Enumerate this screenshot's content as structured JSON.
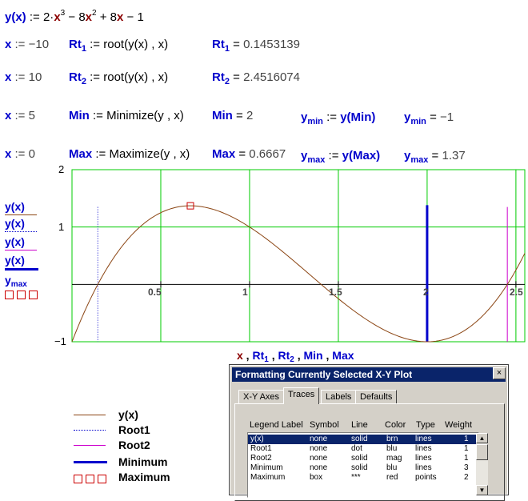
{
  "worksheet": {
    "def": {
      "lhs": "y(x)",
      "assign": ":=",
      "rhs_prefix": "2·",
      "x1": "x",
      "e3": "3",
      "mid": "− 8",
      "x2": "x",
      "e2": "2",
      "mid2": "+ 8",
      "x3": "x",
      "tail": "− 1"
    },
    "lines": [
      {
        "guess_var": "x",
        "guess_op": ":=",
        "guess_val": "−10",
        "name": "Rt",
        "name_sub": "1",
        "op": ":=",
        "func": "root",
        "args": "(y(x) , x)",
        "res_name": "Rt",
        "res_sub": "1",
        "res_eq": "=",
        "res_val": "0.1453139"
      },
      {
        "guess_var": "x",
        "guess_op": ":=",
        "guess_val": "10",
        "name": "Rt",
        "name_sub": "2",
        "op": ":=",
        "func": "root",
        "args": "(y(x) , x)",
        "res_name": "Rt",
        "res_sub": "2",
        "res_eq": "=",
        "res_val": "2.4516074"
      },
      {
        "guess_var": "x",
        "guess_op": ":=",
        "guess_val": "5",
        "name": "Min",
        "name_sub": "",
        "op": ":=",
        "func": "Minimize",
        "args": "(y , x)",
        "res_name": "Min",
        "res_sub": "",
        "res_eq": "=",
        "res_val": "2"
      },
      {
        "guess_var": "x",
        "guess_op": ":=",
        "guess_val": "0",
        "name": "Max",
        "name_sub": "",
        "op": ":=",
        "func": "Maximize",
        "args": "(y , x)",
        "res_name": "Max",
        "res_sub": "",
        "res_eq": "=",
        "res_val": "0.6667"
      }
    ],
    "ymin": {
      "def_name": "y",
      "def_sub": "min",
      "def_op": ":=",
      "def_expr": "y(Min)",
      "res_name": "y",
      "res_sub": "min",
      "res_eq": "=",
      "res_val": "−1"
    },
    "ymax": {
      "def_name": "y",
      "def_sub": "max",
      "def_op": ":=",
      "def_expr": "y(Max)",
      "res_name": "y",
      "res_sub": "max",
      "res_eq": "=",
      "res_val": "1.37"
    }
  },
  "plot": {
    "x_axis_expr": "x , Rt1 , Rt2 , Min , Max",
    "x_axis_parts": [
      "x",
      "Rt",
      "1",
      "Rt",
      "2",
      "Min",
      "Max"
    ],
    "y_axis_labels": [
      "y(x)",
      "y(x)",
      "y(x)",
      "y(x)",
      "ymax"
    ],
    "y_axis_last": {
      "base": "y",
      "sub": "max"
    },
    "y_ticks": [
      "2",
      "1",
      "−1"
    ],
    "x_ticks": [
      "0.5",
      "1",
      "1.5",
      "2",
      "2.5"
    ]
  },
  "chart_data": {
    "type": "line",
    "xlim": [
      0,
      2.55
    ],
    "ylim": [
      -1,
      2
    ],
    "grid": true,
    "series": [
      {
        "name": "y(x)",
        "style": "solid",
        "color": "#8b4513",
        "function": "2x^3 - 8x^2 + 8x - 1"
      },
      {
        "name": "Root1",
        "style": "dot",
        "color": "#0000cc",
        "x": 0.1453139
      },
      {
        "name": "Root2",
        "style": "solid",
        "color": "#cc00cc",
        "x": 2.4516074
      },
      {
        "name": "Minimum",
        "style": "solid",
        "color": "#0000cc",
        "x": 2,
        "y": -1
      },
      {
        "name": "Maximum",
        "style": "box",
        "color": "#cc0000",
        "x": 0.6667,
        "y": 1.37
      }
    ]
  },
  "legend": [
    "y(x)",
    "Root1",
    "Root2",
    "Minimum",
    "Maximum"
  ],
  "dialog": {
    "title": "Formatting Currently Selected X-Y Plot",
    "close": "×",
    "tabs": [
      "X-Y Axes",
      "Traces",
      "Labels",
      "Defaults"
    ],
    "active_tab": "Traces",
    "headers": [
      "Legend Label",
      "Symbol",
      "Line",
      "Color",
      "Type",
      "Weight"
    ],
    "rows": [
      [
        "y(x)",
        "none",
        "solid",
        "brn",
        "lines",
        "1"
      ],
      [
        "Root1",
        "none",
        "dot",
        "blu",
        "lines",
        "1"
      ],
      [
        "Root2",
        "none",
        "solid",
        "mag",
        "lines",
        "1"
      ],
      [
        "Minimum",
        "none",
        "solid",
        "blu",
        "lines",
        "3"
      ],
      [
        "Maximum",
        "box",
        "***",
        "red",
        "points",
        "2"
      ]
    ]
  }
}
